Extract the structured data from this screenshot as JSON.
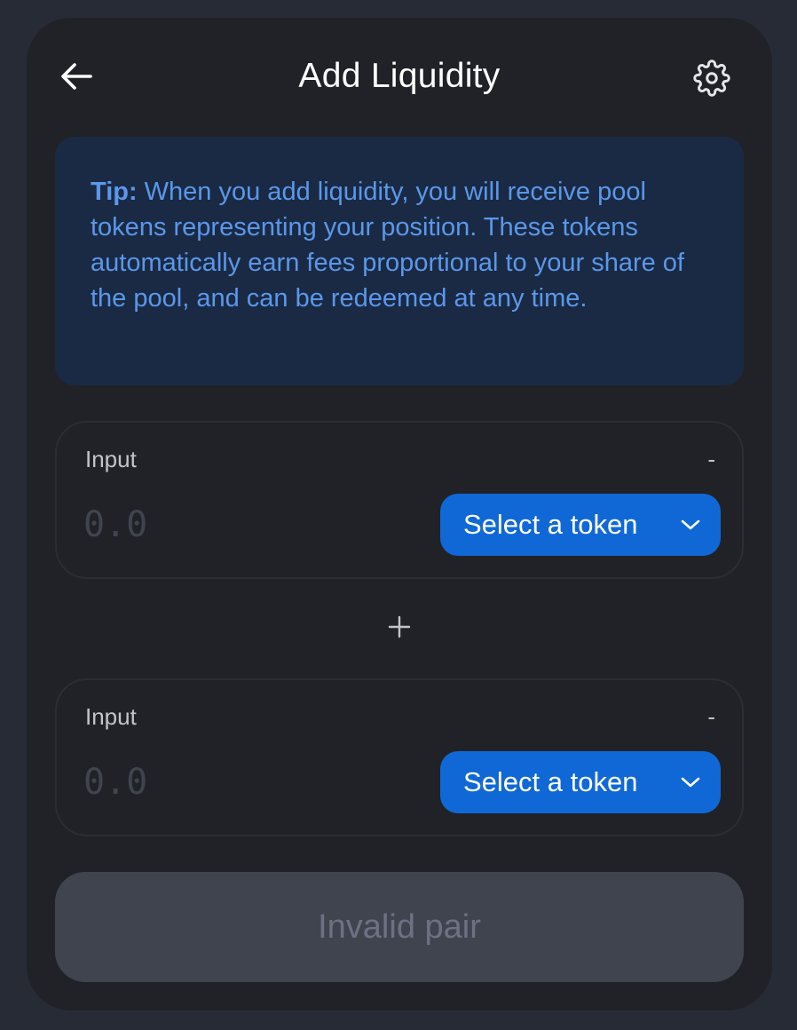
{
  "header": {
    "title": "Add Liquidity",
    "back_icon": "arrow-left-icon",
    "settings_icon": "gear-icon"
  },
  "tip": {
    "label": "Tip:",
    "text": " When you add liquidity, you will receive pool tokens representing your position. These tokens automatically earn fees proportional to your share of the pool, and can be redeemed at any time."
  },
  "inputs": [
    {
      "label": "Input",
      "balance": "-",
      "placeholder": "0.0",
      "token_button": "Select a token"
    },
    {
      "label": "Input",
      "balance": "-",
      "placeholder": "0.0",
      "token_button": "Select a token"
    }
  ],
  "separator_icon": "plus-icon",
  "submit": {
    "label": "Invalid pair"
  },
  "colors": {
    "background": "#272b36",
    "card": "#212227",
    "tip_bg": "#1a2a44",
    "tip_text": "#5b97ea",
    "accent": "#1068d6",
    "disabled_button": "#40444f",
    "disabled_text": "#6c7284"
  }
}
